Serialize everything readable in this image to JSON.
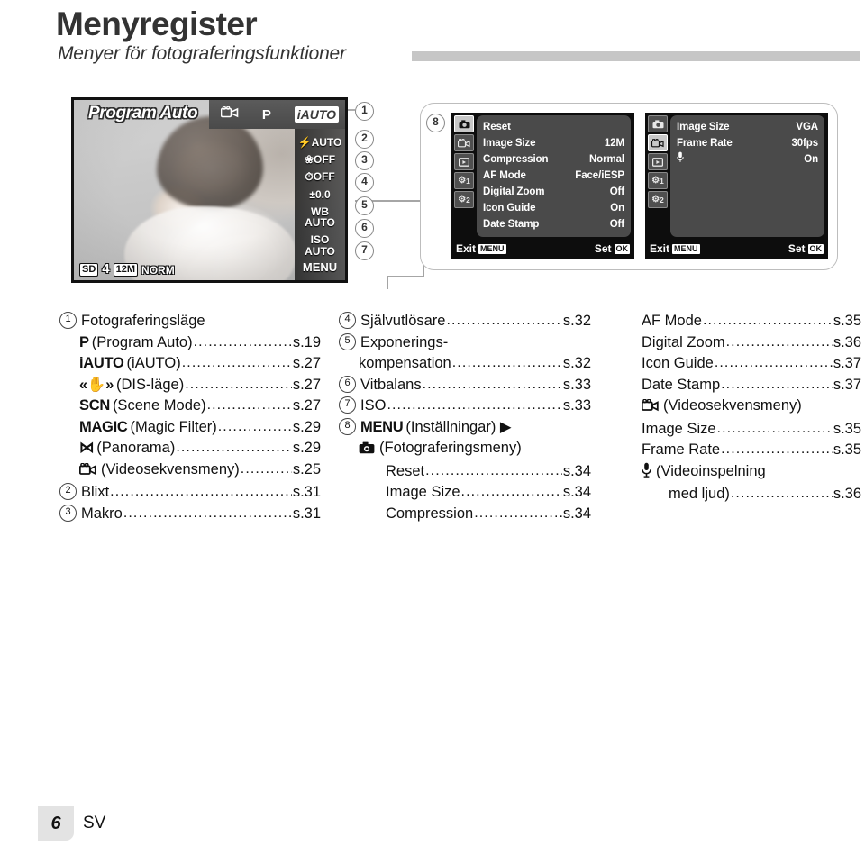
{
  "header": {
    "title": "Menyregister",
    "subtitle": "Menyer för fotograferingsfunktioner"
  },
  "camera_screen": {
    "mode_label": "Program Auto",
    "topbar": {
      "movie_icon": "movie-camera-icon",
      "p_label": "P",
      "iauto_label": "iAUTO"
    },
    "right_icons": [
      {
        "name": "flash-icon",
        "label": "AUTO"
      },
      {
        "name": "macro-icon",
        "label": "OFF"
      },
      {
        "name": "selftimer-icon",
        "label": "OFF"
      },
      {
        "name": "exposure-compensation-icon",
        "label": "±0.0"
      },
      {
        "name": "white-balance-icon",
        "label": "WB\nAUTO"
      },
      {
        "name": "iso-icon",
        "label": "ISO\nAUTO"
      }
    ],
    "menu_label": "MENU",
    "status_bar": {
      "card": "SD",
      "battery": "4",
      "image_size": "12M",
      "compression": "NORM"
    }
  },
  "callouts": [
    "1",
    "2",
    "3",
    "4",
    "5",
    "6",
    "7",
    "8"
  ],
  "menu_panel_1": {
    "tabs": [
      "still-camera-tab",
      "movie-tab",
      "playback-tab",
      "settings-1-tab",
      "settings-2-tab"
    ],
    "tab_labels": [
      "",
      "",
      "",
      "1",
      "2"
    ],
    "active_tab_index": 0,
    "rows": [
      {
        "label": "Reset",
        "value": ""
      },
      {
        "label": "Image Size",
        "value": "12M"
      },
      {
        "label": "Compression",
        "value": "Normal"
      },
      {
        "label": "AF Mode",
        "value": "Face/iESP"
      },
      {
        "label": "Digital Zoom",
        "value": "Off"
      },
      {
        "label": "Icon Guide",
        "value": "On"
      },
      {
        "label": "Date Stamp",
        "value": "Off"
      }
    ],
    "footer_exit": "Exit",
    "footer_exit_key": "MENU",
    "footer_set": "Set",
    "footer_set_key": "OK"
  },
  "menu_panel_2": {
    "tabs": [
      "still-camera-tab",
      "movie-tab",
      "playback-tab",
      "settings-1-tab",
      "settings-2-tab"
    ],
    "tab_labels": [
      "",
      "",
      "",
      "1",
      "2"
    ],
    "active_tab_index": 1,
    "rows": [
      {
        "label": "Image Size",
        "value": "VGA"
      },
      {
        "label": "Frame Rate",
        "value": "30fps"
      },
      {
        "label": "",
        "value": "On",
        "icon": "microphone-icon"
      }
    ],
    "footer_exit": "Exit",
    "footer_exit_key": "MENU",
    "footer_set": "Set",
    "footer_set_key": "OK"
  },
  "index": {
    "column_1": [
      {
        "num": "1",
        "icon": "",
        "label": "Fotograferingsläge",
        "page": "",
        "dots": false,
        "indent": 0
      },
      {
        "num": "",
        "icon": "P",
        "label": "(Program Auto)",
        "page": "s.19",
        "dots": true,
        "indent": 1
      },
      {
        "num": "",
        "icon": "iAUTO",
        "label": "(iAUTO)",
        "page": "s.27",
        "dots": true,
        "indent": 1
      },
      {
        "num": "",
        "icon": "«✋»",
        "label": "(DIS-läge)",
        "page": "s.27",
        "dots": true,
        "indent": 1
      },
      {
        "num": "",
        "icon": "SCN",
        "label": "(Scene Mode)",
        "page": "s.27",
        "dots": true,
        "indent": 1
      },
      {
        "num": "",
        "icon": "MAGIC",
        "label": "(Magic Filter)",
        "page": "s.29",
        "dots": true,
        "indent": 1
      },
      {
        "num": "",
        "icon": "⋈",
        "label": "(Panorama)",
        "page": "s.29",
        "dots": true,
        "indent": 1
      },
      {
        "num": "",
        "icon": "movie",
        "label": "(Videosekvensmeny)",
        "page": "s.25",
        "dots": true,
        "indent": 1
      },
      {
        "num": "2",
        "icon": "",
        "label": "Blixt",
        "page": "s.31",
        "dots": true,
        "indent": 0
      },
      {
        "num": "3",
        "icon": "",
        "label": "Makro",
        "page": "s.31",
        "dots": true,
        "indent": 0
      }
    ],
    "column_2": [
      {
        "num": "4",
        "icon": "",
        "label": "Självutlösare",
        "page": "s.32",
        "dots": true,
        "indent": 0
      },
      {
        "num": "5",
        "icon": "",
        "label": "Exponerings-",
        "page": "",
        "dots": false,
        "indent": 0
      },
      {
        "num": "",
        "icon": "",
        "label": "kompensation",
        "page": "s.32",
        "dots": true,
        "indent": 1
      },
      {
        "num": "6",
        "icon": "",
        "label": "Vitbalans",
        "page": "s.33",
        "dots": true,
        "indent": 0
      },
      {
        "num": "7",
        "icon": "",
        "label": "ISO",
        "page": "s.33",
        "dots": true,
        "indent": 0
      },
      {
        "num": "8",
        "icon": "MENU",
        "label": "(Inställningar) ▶",
        "page": "",
        "dots": false,
        "indent": 0
      },
      {
        "num": "",
        "icon": "camera",
        "label": "(Fotograferingsmeny)",
        "page": "",
        "dots": false,
        "indent": 1
      },
      {
        "num": "",
        "icon": "",
        "label": "Reset",
        "page": "s.34",
        "dots": true,
        "indent": 2
      },
      {
        "num": "",
        "icon": "",
        "label": "Image Size",
        "page": "s.34",
        "dots": true,
        "indent": 2
      },
      {
        "num": "",
        "icon": "",
        "label": "Compression",
        "page": "s.34",
        "dots": true,
        "indent": 2
      }
    ],
    "column_3": [
      {
        "num": "",
        "icon": "",
        "label": "AF Mode",
        "page": "s.35",
        "dots": true,
        "indent": 1
      },
      {
        "num": "",
        "icon": "",
        "label": "Digital Zoom",
        "page": "s.36",
        "dots": true,
        "indent": 1
      },
      {
        "num": "",
        "icon": "",
        "label": "Icon Guide",
        "page": "s.37",
        "dots": true,
        "indent": 1
      },
      {
        "num": "",
        "icon": "",
        "label": "Date Stamp",
        "page": "s.37",
        "dots": true,
        "indent": 1
      },
      {
        "num": "",
        "icon": "movie",
        "label": "(Videosekvensmeny)",
        "page": "",
        "dots": false,
        "indent": 0
      },
      {
        "num": "",
        "icon": "",
        "label": "Image Size",
        "page": "s.35",
        "dots": true,
        "indent": 1
      },
      {
        "num": "",
        "icon": "",
        "label": "Frame Rate",
        "page": "s.35",
        "dots": true,
        "indent": 1
      },
      {
        "num": "",
        "icon": "mic",
        "label": "(Videoinspelning",
        "page": "",
        "dots": false,
        "indent": 1
      },
      {
        "num": "",
        "icon": "",
        "label": "med ljud)",
        "page": "s.36",
        "dots": true,
        "indent": 2
      }
    ]
  },
  "footer": {
    "page_number": "6",
    "language": "SV"
  }
}
